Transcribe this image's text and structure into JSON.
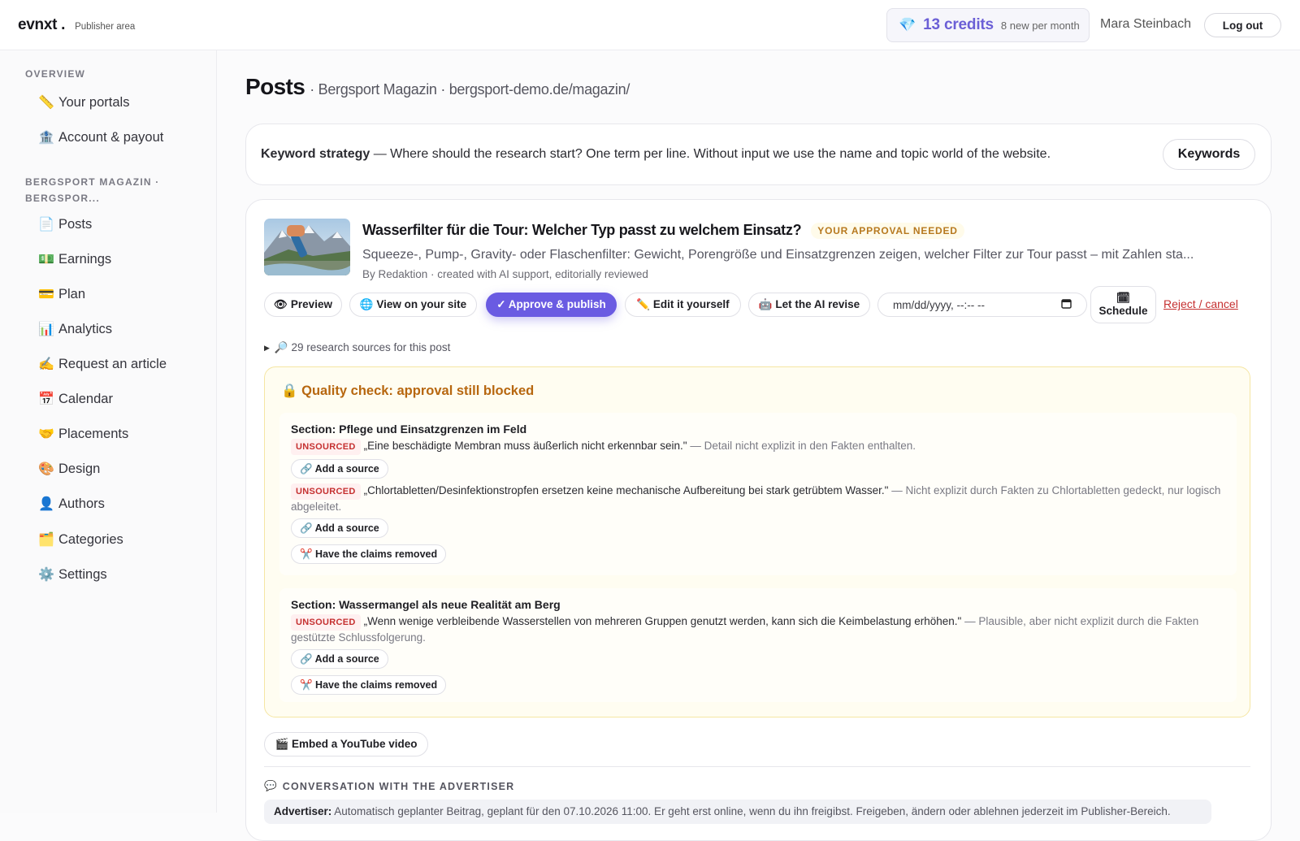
{
  "header": {
    "logo": "evnxt .",
    "area": "Publisher area",
    "credits_count": "13 credits",
    "credits_sub": "8 new per month",
    "credits_icon": "gem-icon",
    "user_name": "Mara Steinbach",
    "logout_label": "Log out"
  },
  "sidebar": {
    "overview_heading": "OVERVIEW",
    "overview_items": [
      {
        "icon": "📏",
        "label": "Your portals"
      },
      {
        "icon": "🏦",
        "label": "Account & payout"
      }
    ],
    "portal_heading": "BERGSPORT MAGAZIN · BERGSPOR...",
    "portal_items": [
      {
        "icon": "📄",
        "label": "Posts"
      },
      {
        "icon": "💵",
        "label": "Earnings"
      },
      {
        "icon": "💳",
        "label": "Plan"
      },
      {
        "icon": "📊",
        "label": "Analytics"
      },
      {
        "icon": "✍️",
        "label": "Request an article"
      },
      {
        "icon": "📅",
        "label": "Calendar"
      },
      {
        "icon": "🤝",
        "label": "Placements"
      },
      {
        "icon": "🎨",
        "label": "Design"
      },
      {
        "icon": "👤",
        "label": "Authors"
      },
      {
        "icon": "🗂️",
        "label": "Categories"
      },
      {
        "icon": "⚙️",
        "label": "Settings"
      }
    ]
  },
  "page": {
    "title": "Posts",
    "breadcrumb": "· Bergsport Magazin · bergsport-demo.de/magazin/"
  },
  "keyword_strategy": {
    "label": "Keyword strategy",
    "text": " — Where should the research start? One term per line. Without input we use the name and topic world of the website.",
    "button": "Keywords"
  },
  "post": {
    "title": "Wasserfilter für die Tour: Welcher Typ passt zu welchem Einsatz?",
    "status_badge": "YOUR APPROVAL NEEDED",
    "excerpt": "Squeeze-, Pump-, Gravity- oder Flaschenfilter: Gewicht, Porengröße und Einsatzgrenzen zeigen, welcher Filter zur Tour passt – mit Zahlen sta...",
    "byline": "By Redaktion · created with AI support, editorially reviewed",
    "actions": {
      "preview": "👁 Preview",
      "view_site": "🌐 View on your site",
      "approve": "✓ Approve & publish",
      "edit": "✏️ Edit it yourself",
      "ai_revise": "🤖 Let the AI revise",
      "date_placeholder": "mm/dd/yyyy, --:-- --",
      "schedule_icon": "🗓",
      "schedule": "Schedule",
      "reject": "Reject / cancel"
    },
    "sources": "🔎 29 research sources for this post"
  },
  "quality_check": {
    "title": "🔒 Quality check: approval still blocked",
    "tag": "UNSOURCED",
    "add_source": "🔗 Add a source",
    "remove_claims": "✂️ Have the claims removed",
    "sections": [
      {
        "title": "Section: Pflege und Einsatzgrenzen im Feld",
        "claims": [
          {
            "quote": "„Eine beschädigte Membran muss äußerlich nicht erkennbar sein.\"",
            "note": " — Detail nicht explizit in den Fakten enthalten."
          },
          {
            "quote": "„Chlortabletten/Desinfektionstropfen ersetzen keine mechanische Aufbereitung bei stark getrübtem Wasser.\"",
            "note": " — Nicht explizit durch Fakten zu Chlortabletten gedeckt, nur logisch abgeleitet."
          }
        ]
      },
      {
        "title": "Section: Wassermangel als neue Realität am Berg",
        "claims": [
          {
            "quote": "„Wenn wenige verbleibende Wasserstellen von mehreren Gruppen genutzt werden, kann sich die Keimbelastung erhöhen.\"",
            "note": " — Plausible, aber nicht explizit durch die Fakten gestützte Schlussfolgerung."
          }
        ]
      }
    ]
  },
  "youtube_button": "🎬 Embed a YouTube video",
  "conversation": {
    "heading": "CONVERSATION WITH THE ADVERTISER",
    "heading_icon": "💬",
    "author": "Advertiser:",
    "message": " Automatisch geplanter Beitrag, geplant für den 07.10.2026 11:00. Er geht erst online, wenn du ihn freigibst. Freigeben, ändern oder ablehnen jederzeit im Publisher-Bereich."
  },
  "colors": {
    "accent": "#6a5be2",
    "warning": "#b7670f",
    "danger": "#c53030"
  }
}
